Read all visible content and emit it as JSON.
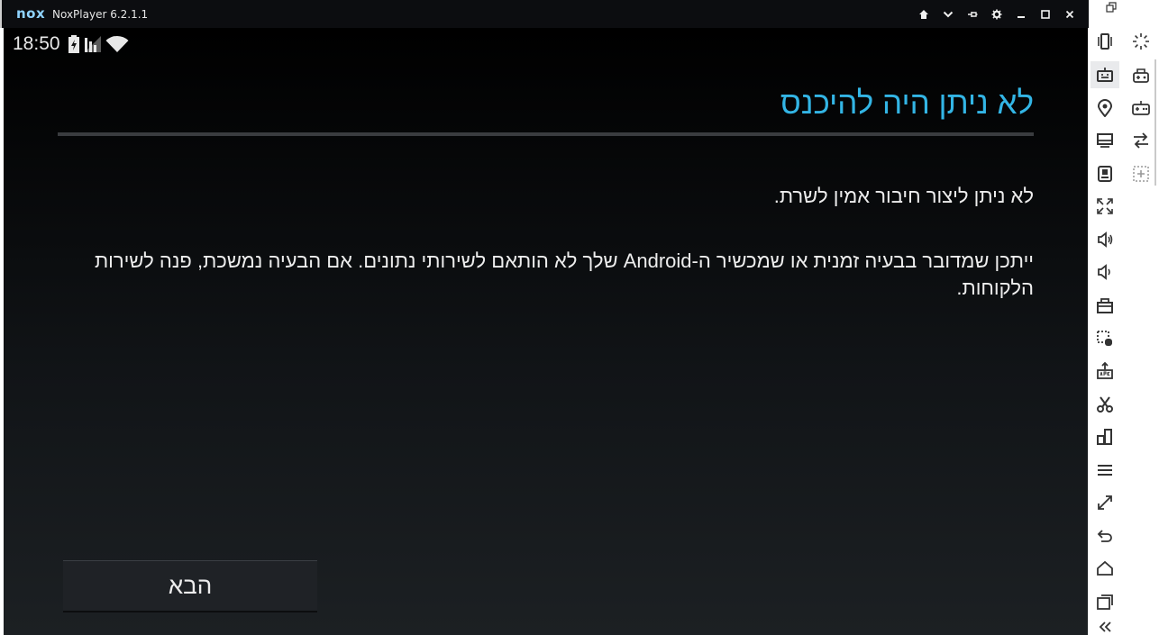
{
  "window": {
    "logo": "nox",
    "title": "NoxPlayer 6.2.1.1",
    "controls": [
      "home-icon",
      "chevron-down-icon",
      "pin-icon",
      "gear-icon",
      "minimize-icon",
      "maximize-icon",
      "close-icon"
    ]
  },
  "statusbar": {
    "time": "18:50",
    "icons": [
      "battery-icon",
      "signal-icon",
      "wifi-icon"
    ]
  },
  "dialog": {
    "title": "לא ניתן היה להיכנס",
    "message1": "לא ניתן ליצור חיבור אמין לשרת.",
    "message2": "ייתכן שמדובר בבעיה זמנית או שמכשיר ה-Android שלך לא הותאם לשירותי נתונים. אם הבעיה נמשכת, פנה לשירות הלקוחות.",
    "next_button": "הבא"
  },
  "sidebar": {
    "items": [
      "phone-shake-icon",
      "keyboard-icon",
      "location-icon",
      "screen-icon",
      "install-apk-icon",
      "fullscreen-icon",
      "volume-up-icon",
      "volume-down-icon",
      "toolbox-icon",
      "screenshot-select-icon",
      "apk-icon",
      "scissors-icon",
      "multi-instance-icon",
      "menu-icon",
      "resize-icon",
      "back-icon",
      "home-icon",
      "recent-apps-icon",
      "collapse-icon"
    ],
    "active": "keyboard-icon"
  },
  "sidebar2": {
    "items": [
      "loading-icon",
      "gamepad-icon",
      "controller-icon",
      "swap-icon",
      "add-frame-icon"
    ]
  },
  "colors": {
    "accent": "#33b5e5",
    "titlebar": "#0c0d10",
    "icon": "#333333"
  }
}
